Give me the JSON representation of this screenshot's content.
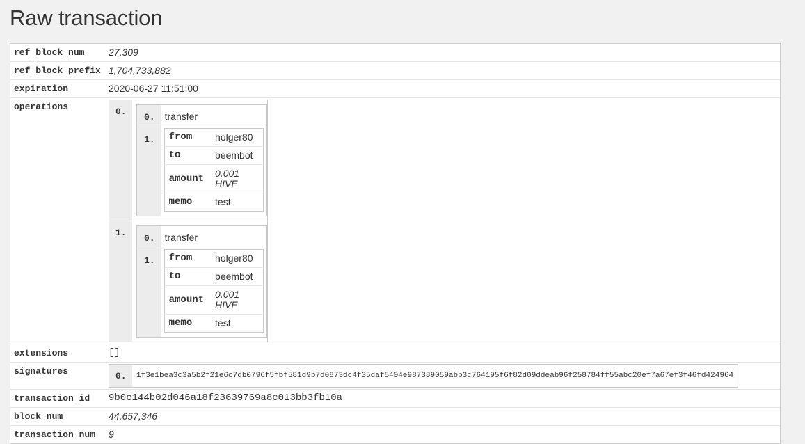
{
  "page": {
    "title": "Raw transaction"
  },
  "fields": {
    "ref_block_num": {
      "key": "ref_block_num",
      "value": "27,309"
    },
    "ref_block_prefix": {
      "key": "ref_block_prefix",
      "value": "1,704,733,882"
    },
    "expiration": {
      "key": "expiration",
      "value": "2020-06-27 11:51:00"
    },
    "operations": {
      "key": "operations"
    },
    "extensions": {
      "key": "extensions",
      "value": "[]"
    },
    "signatures": {
      "key": "signatures"
    },
    "transaction_id": {
      "key": "transaction_id",
      "value": "9b0c144b02d046a18f23639769a8c013bb3fb10a"
    },
    "block_num": {
      "key": "block_num",
      "value": "44,657,346"
    },
    "transaction_num": {
      "key": "transaction_num",
      "value": "9"
    }
  },
  "operations": [
    {
      "index": "0.",
      "type_index": "0.",
      "type": "transfer",
      "args_index": "1.",
      "args": [
        {
          "key": "from",
          "value": "holger80"
        },
        {
          "key": "to",
          "value": "beembot"
        },
        {
          "key": "amount",
          "value": "0.001 HIVE"
        },
        {
          "key": "memo",
          "value": "test"
        }
      ]
    },
    {
      "index": "1.",
      "type_index": "0.",
      "type": "transfer",
      "args_index": "1.",
      "args": [
        {
          "key": "from",
          "value": "holger80"
        },
        {
          "key": "to",
          "value": "beembot"
        },
        {
          "key": "amount",
          "value": "0.001 HIVE"
        },
        {
          "key": "memo",
          "value": "test"
        }
      ]
    }
  ],
  "signatures": [
    {
      "index": "0.",
      "value": "1f3e1bea3c3a5b2f21e6c7db0796f5fbf581d9b7d0873dc4f35daf5404e987389059abb3c764195f6f82d09ddeab96f258784ff55abc20ef7a67ef3f46fd424964"
    }
  ]
}
